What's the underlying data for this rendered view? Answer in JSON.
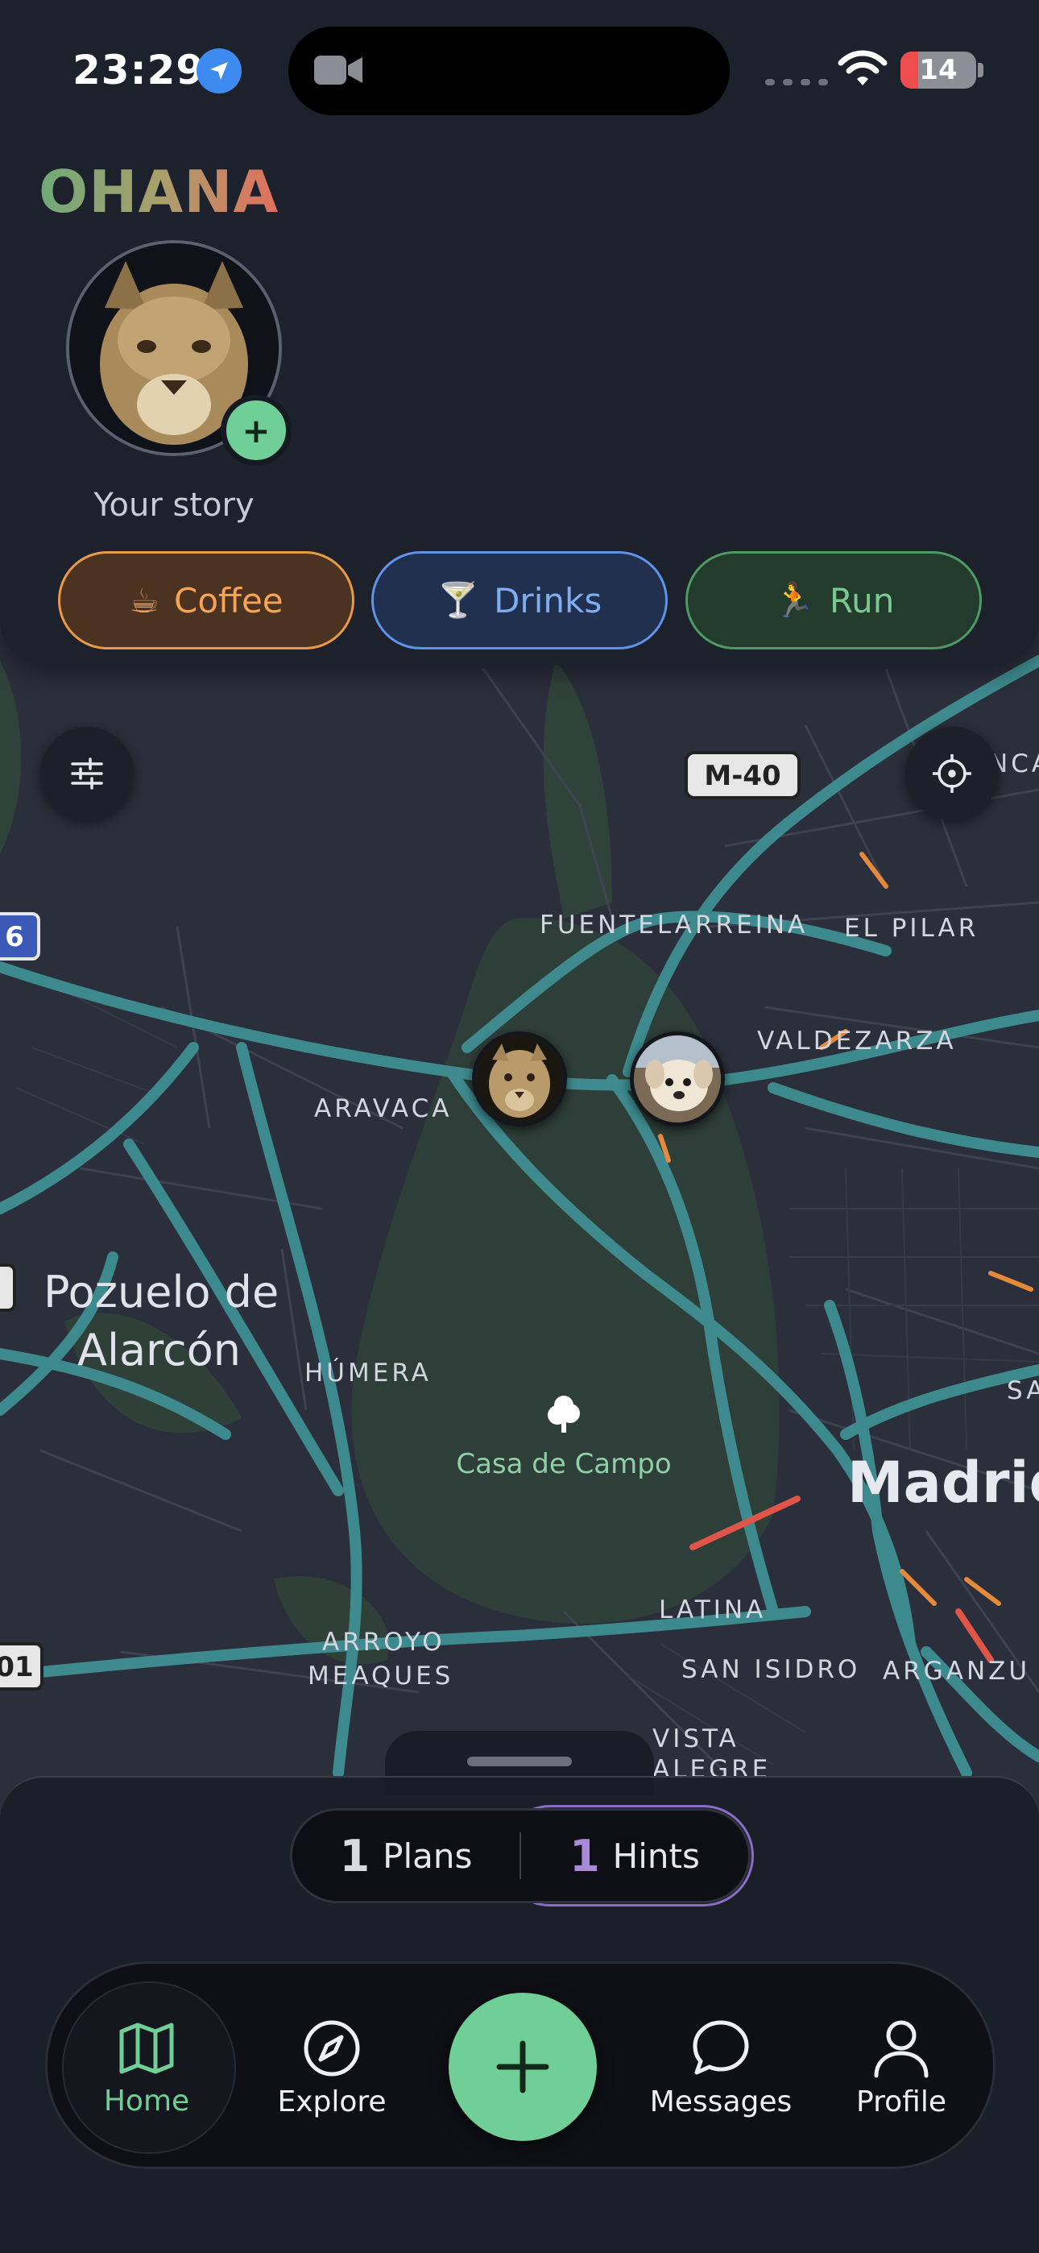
{
  "status_bar": {
    "time": "23:29",
    "battery": "14"
  },
  "app": {
    "title": "OHANA"
  },
  "story": {
    "label": "Your story",
    "add": "+"
  },
  "activities": [
    {
      "emoji": "☕",
      "label": "Coffee"
    },
    {
      "emoji": "🍸",
      "label": "Drinks"
    },
    {
      "emoji": "🏃",
      "label": "Run"
    }
  ],
  "map": {
    "road_shields": [
      "M-40",
      "6",
      "01"
    ],
    "labels": {
      "fuentelarreina": "FUENTELARREINA",
      "el_pilar": "EL PILAR",
      "valdezarza": "VALDEZARZA",
      "aravaca": "ARAVACA",
      "pozuelo_1": "Pozuelo de",
      "pozuelo_2": "Alarcón",
      "humera": "HÚMERA",
      "casa_de_campo": "Casa de Campo",
      "madrid": "Madrid",
      "latina": "LATINA",
      "arroyo_1": "ARROYO",
      "arroyo_2": "MEAQUES",
      "san_isidro": "SAN ISIDRO",
      "arganzuela": "ARGANZU",
      "vista_alegre_1": "VISTA",
      "vista_alegre_2": "ALEGRE",
      "nca": "NCA",
      "sa": "SA"
    }
  },
  "counts": {
    "plans": {
      "count": "1",
      "label": "Plans"
    },
    "hints": {
      "count": "1",
      "label": "Hints"
    }
  },
  "nav": {
    "home": "Home",
    "explore": "Explore",
    "create": "+",
    "messages": "Messages",
    "profile": "Profile"
  },
  "colors": {
    "accent_green": "#6fcf97",
    "coffee": "#f4a452",
    "drinks": "#7eaef2",
    "run": "#79c88e",
    "hints": "#a98ad8"
  }
}
